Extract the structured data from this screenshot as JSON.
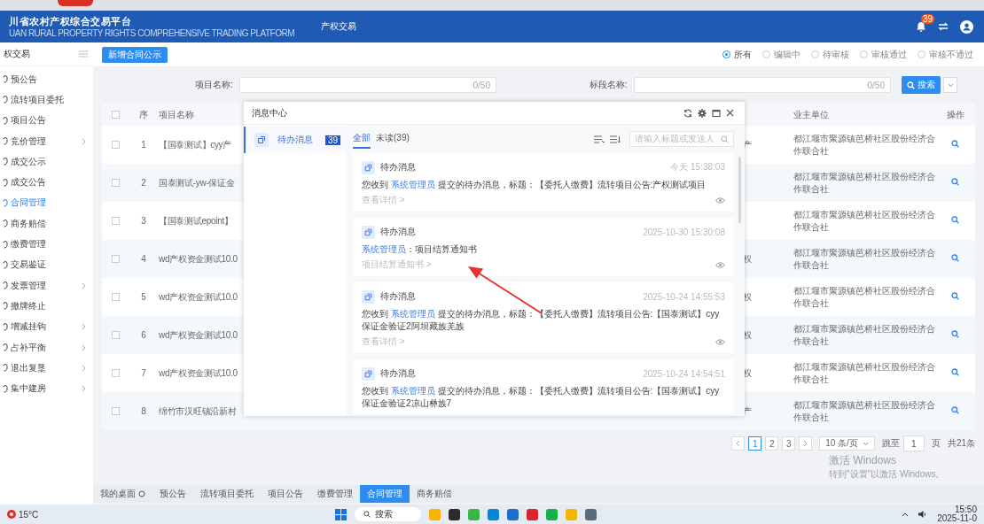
{
  "header": {
    "logo_title": "川省农村产权综合交易平台",
    "logo_subtitle": "UAN RURAL PROPERTY RIGHTS COMPREHENSIVE TRADING PLATFORM",
    "nav_item": "产权交易",
    "notification_count": "39"
  },
  "sidebar": {
    "title": "权交易",
    "items": [
      {
        "label": "预公告",
        "selected": false,
        "has_children": false
      },
      {
        "label": "流转项目委托",
        "selected": false,
        "has_children": false
      },
      {
        "label": "项目公告",
        "selected": false,
        "has_children": false
      },
      {
        "label": "竞价管理",
        "selected": false,
        "has_children": true
      },
      {
        "label": "成交公示",
        "selected": false,
        "has_children": false
      },
      {
        "label": "成交公告",
        "selected": false,
        "has_children": false
      },
      {
        "label": "合同管理",
        "selected": true,
        "has_children": false
      },
      {
        "label": "商务赔偿",
        "selected": false,
        "has_children": false
      },
      {
        "label": "缴费管理",
        "selected": false,
        "has_children": false
      },
      {
        "label": "交易鉴证",
        "selected": false,
        "has_children": false
      },
      {
        "label": "发票管理",
        "selected": false,
        "has_children": true
      },
      {
        "label": "撤牌终止",
        "selected": false,
        "has_children": false
      },
      {
        "label": "增减挂钩",
        "selected": false,
        "has_children": true
      },
      {
        "label": "占补平衡",
        "selected": false,
        "has_children": true
      },
      {
        "label": "退出复垦",
        "selected": false,
        "has_children": true
      },
      {
        "label": "集中建房",
        "selected": false,
        "has_children": true
      }
    ]
  },
  "toolbar": {
    "add_button": "新增合同公示",
    "status_filter": [
      {
        "label": "所有",
        "selected": true
      },
      {
        "label": "编辑中",
        "selected": false
      },
      {
        "label": "待审核",
        "selected": false
      },
      {
        "label": "审核通过",
        "selected": false
      },
      {
        "label": "审核不通过",
        "selected": false
      }
    ]
  },
  "search": {
    "fields": [
      {
        "label": "项目名称:",
        "counter": "0/50"
      },
      {
        "label": "标段名称:",
        "counter": "0/50"
      }
    ],
    "search_button": "搜索"
  },
  "table": {
    "select_all_checked": false,
    "columns": {
      "seq": "序",
      "name": "项目名称",
      "owner": "业主单位",
      "actions": "操作"
    },
    "rows": [
      {
        "checked": false,
        "seq": "1",
        "name": "【国泰测试】cyy产",
        "column_4": "产",
        "owner": "都江堰市聚源镇芭桥社区股份经济合作联合社"
      },
      {
        "checked": false,
        "seq": "2",
        "name": "国泰测试-yw-保证金",
        "owner": "都江堰市聚源镇芭桥社区股份经济合作联合社"
      },
      {
        "checked": false,
        "seq": "3",
        "name": "【国泰测试epoint】",
        "owner": "都江堰市聚源镇芭桥社区股份经济合作联合社"
      },
      {
        "checked": false,
        "seq": "4",
        "name": "wd产权资金测试10.0",
        "column_4": "权",
        "owner": "都江堰市聚源镇芭桥社区股份经济合作联合社"
      },
      {
        "checked": false,
        "seq": "5",
        "name": "wd产权资金测试10.0",
        "column_4": "权",
        "owner": "都江堰市聚源镇芭桥社区股份经济合作联合社"
      },
      {
        "checked": false,
        "seq": "6",
        "name": "wd产权资金测试10.0",
        "column_4": "权",
        "owner": "都江堰市聚源镇芭桥社区股份经济合作联合社"
      },
      {
        "checked": false,
        "seq": "7",
        "name": "wd产权资金测试10.0",
        "column_4": "权",
        "owner": "都江堰市聚源镇芭桥社区股份经济合作联合社"
      },
      {
        "checked": false,
        "seq": "8",
        "name": "绵竹市汉旺镇沿新村",
        "column_4": "产",
        "owner": "都江堰市聚源镇芭桥社区股份经济合作联合社"
      }
    ]
  },
  "pagination": {
    "pages": [
      {
        "label": "1",
        "selected": true
      },
      {
        "label": "2",
        "selected": false
      },
      {
        "label": "3",
        "selected": false
      }
    ],
    "page_size": "10 条/页",
    "jump_label": "跳至",
    "jump_value": "1",
    "page_unit": "页",
    "total": "共21条"
  },
  "bottom_tabs": [
    {
      "label": "我的桌面",
      "kind": "home",
      "selected": false
    },
    {
      "label": "预公告",
      "kind": "page",
      "selected": false
    },
    {
      "label": "流转项目委托",
      "kind": "page",
      "selected": false
    },
    {
      "label": "项目公告",
      "kind": "page",
      "selected": false
    },
    {
      "label": "缴费管理",
      "kind": "page",
      "selected": false
    },
    {
      "label": "合同管理",
      "kind": "page",
      "selected": true
    },
    {
      "label": "商务赔偿",
      "kind": "page",
      "selected": false
    }
  ],
  "message_center": {
    "title": "消息中心",
    "categories": [
      {
        "label": "待办消息",
        "count": "39",
        "selected": true
      }
    ],
    "tabs": [
      {
        "label": "全部",
        "selected": true
      },
      {
        "label": "未读(39)",
        "selected": false
      }
    ],
    "search_placeholder": "请输入标题或发送人",
    "messages": [
      {
        "type": "待办消息",
        "time": "今天 15:38:03",
        "prefix": "您收到 ",
        "sender": "系统管理员",
        "suffix": " 提交的待办消息，标题：【委托人缴费】流转项目公告:产权测试项目",
        "detail": "查看详情 >"
      },
      {
        "type": "待办消息",
        "time": "2025-10-30 15:30:08",
        "sender": "系统管理员",
        "suffix": "：项目结算通知书",
        "detail": "项目结算通知书 >"
      },
      {
        "type": "待办消息",
        "time": "2025-10-24 14:55:53",
        "prefix": "您收到 ",
        "sender": "系统管理员",
        "suffix": " 提交的待办消息，标题：【委托人缴费】流转项目公告:【国泰测试】cyy保证金验证2阿坝藏族羌族",
        "detail": "查看详情 >"
      },
      {
        "type": "待办消息",
        "time": "2025-10-24 14:54:51",
        "prefix": "您收到 ",
        "sender": "系统管理员",
        "suffix": " 提交的待办消息，标题：【委托人缴费】流转项目公告:【国泰测试】cyy保证金验证2凉山彝族7"
      }
    ]
  },
  "activation_notice": {
    "title": "激活 Windows",
    "hint": "转到\"设置\"以激活 Windows。"
  },
  "taskbar": {
    "weather": "15°C",
    "search_placeholder": "搜索",
    "time": "15:50",
    "date": "2025-11-0"
  }
}
